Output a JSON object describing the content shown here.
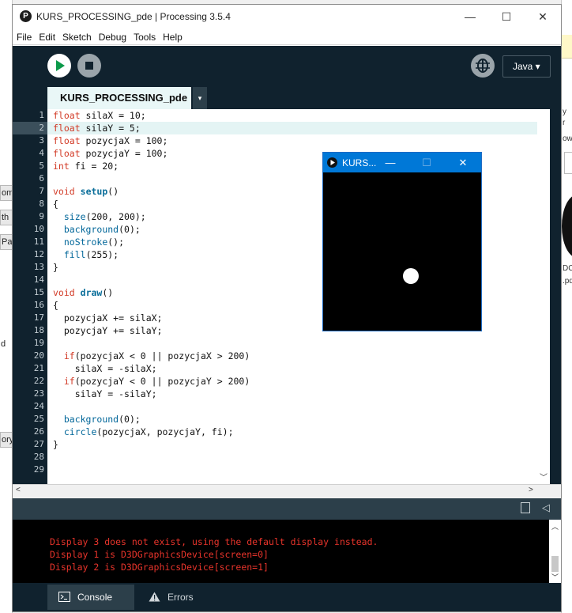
{
  "window": {
    "title": "KURS_PROCESSING_pde | Processing 3.5.4",
    "app_icon": "P",
    "minimize": "—",
    "maximize": "☐",
    "close": "✕"
  },
  "menu": [
    "File",
    "Edit",
    "Sketch",
    "Debug",
    "Tools",
    "Help"
  ],
  "toolbar": {
    "run_icon": "play-icon",
    "stop_icon": "stop-icon",
    "debug_icon": "debugger-icon",
    "mode": "Java ▾"
  },
  "tab": {
    "name": "KURS_PROCESSING_pde",
    "menu_arrow": "▾"
  },
  "editor": {
    "current_line": 2,
    "line_numbers": [
      "1",
      "2",
      "3",
      "4",
      "5",
      "6",
      "7",
      "8",
      "9",
      "10",
      "11",
      "12",
      "13",
      "14",
      "15",
      "16",
      "17",
      "18",
      "19",
      "20",
      "21",
      "22",
      "23",
      "24",
      "25",
      "26",
      "27",
      "28",
      "29"
    ],
    "lines": [
      "float silaX = 10;",
      "float silaY = 5;",
      "float pozycjaX = 100;",
      "float pozycjaY = 100;",
      "int fi = 20;",
      "",
      "void setup()",
      "{",
      "  size(200, 200);",
      "  background(0);",
      "  noStroke();",
      "  fill(255);",
      "}",
      "",
      "void draw()",
      "{",
      "  pozycjaX += silaX;",
      "  pozycjaY += silaY;",
      "",
      "  if(pozycjaX < 0 || pozycjaX > 200)",
      "    silaX = -silaX;",
      "  if(pozycjaY < 0 || pozycjaY > 200)",
      "    silaY = -silaY;",
      "",
      "  background(0);",
      "  circle(pozycjaX, pozycjaY, fi);",
      "}",
      "",
      ""
    ]
  },
  "console": {
    "messages": [
      "Display 3 does not exist, using the default display instead.",
      "Display 1 is D3DGraphicsDevice[screen=0]",
      "Display 2 is D3DGraphicsDevice[screen=1]"
    ],
    "text_color": "#e8342b"
  },
  "footer_tabs": {
    "console": "Console",
    "errors": "Errors"
  },
  "sketch_window": {
    "title": "KURS...",
    "minimize": "—",
    "maximize": "☐",
    "close": "✕",
    "canvas_color": "#000000",
    "ball_color": "#ffffff"
  },
  "background_fragments": {
    "left": [
      "om",
      "th",
      "Pat",
      "d",
      "ory"
    ],
    "right": [
      "y",
      "r",
      "ow",
      "DCE",
      ".pd"
    ]
  },
  "colors": {
    "toolbar_bg": "#10222e",
    "tab_bg": "#e9f7f7",
    "keyword": "#d23a26",
    "function": "#0a6e9a",
    "title_bar_active": "#0078d7"
  }
}
